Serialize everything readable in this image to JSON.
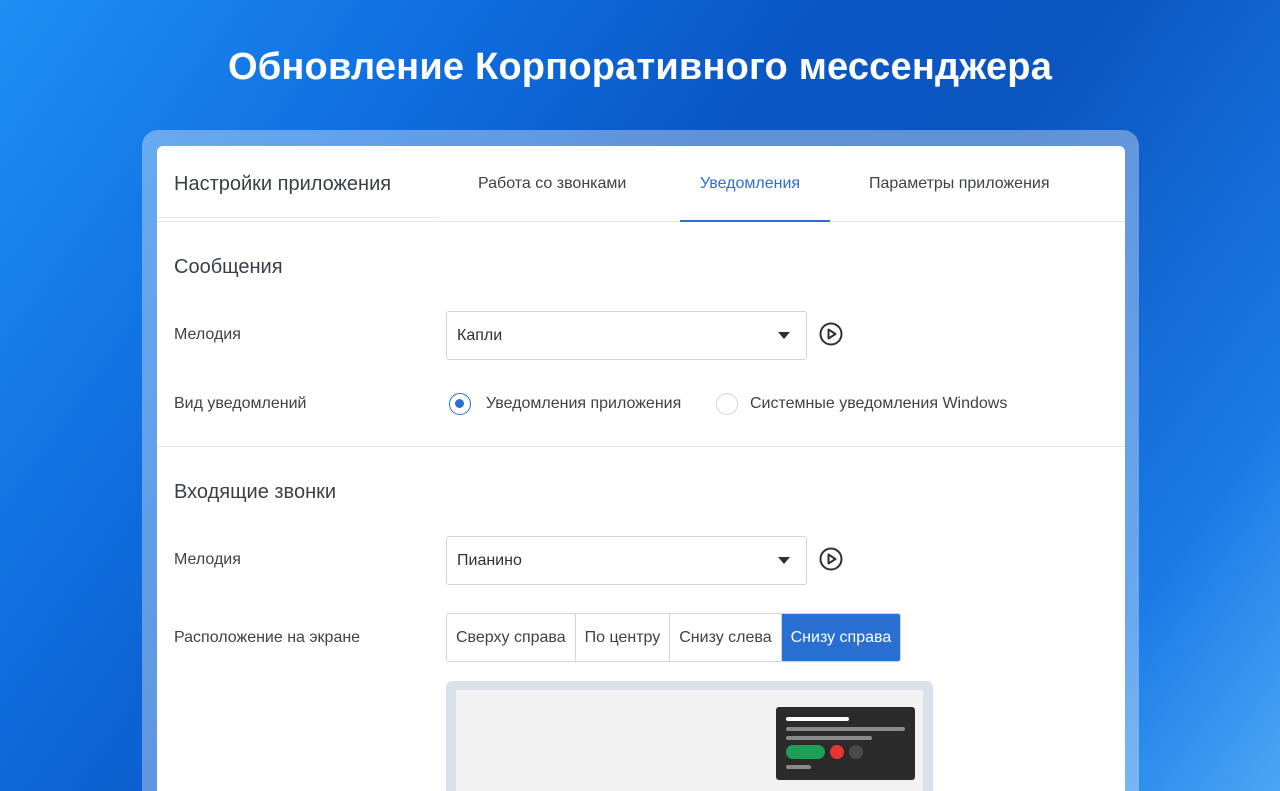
{
  "headline": "Обновление Корпоративного мессенджера",
  "window": {
    "title": "Настройки приложения",
    "tabs": [
      {
        "label": "Работа со звонками",
        "active": false
      },
      {
        "label": "Уведомления",
        "active": true
      },
      {
        "label": "Параметры приложения",
        "active": false
      }
    ]
  },
  "messages": {
    "section_title": "Сообщения",
    "melody_label": "Мелодия",
    "melody_value": "Капли",
    "view_label": "Вид уведомлений",
    "view_options": [
      {
        "label": "Уведомления приложения",
        "checked": true
      },
      {
        "label": "Системные уведомления Windows",
        "checked": false
      }
    ]
  },
  "calls": {
    "section_title": "Входящие звонки",
    "melody_label": "Мелодия",
    "melody_value": "Пианино",
    "position_label": "Расположение на экране",
    "position_options": [
      {
        "label": "Сверху справа",
        "active": false
      },
      {
        "label": "По центру",
        "active": false
      },
      {
        "label": "Снизу слева",
        "active": false
      },
      {
        "label": "Снизу справа",
        "active": true
      }
    ]
  },
  "colors": {
    "accent": "#2a6fd2",
    "accept": "#1e9e57",
    "decline": "#e8352f",
    "muted": "#4a4a4a"
  },
  "icons": {
    "play": "play-circle-icon",
    "caret": "chevron-down-icon"
  }
}
